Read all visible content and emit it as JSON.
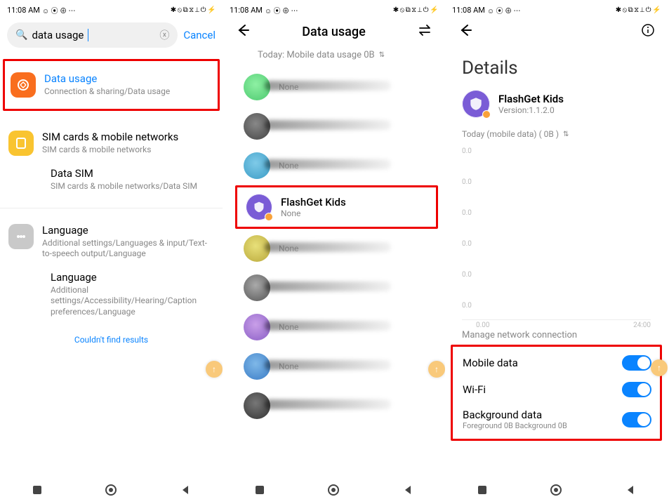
{
  "status": {
    "time": "11:08 AM",
    "left_icons": "☺ ⦿ ⊕ ⋯",
    "right_icons": "✱ ⦸ ⧉ ⧖ ⟂ ⏻ ⚡"
  },
  "panel1": {
    "search_value": "data usage",
    "cancel": "Cancel",
    "result1_title": "Data usage",
    "result1_path": "Connection & sharing/Data usage",
    "group2_title": "SIM cards & mobile networks",
    "group2_path": "SIM cards & mobile networks",
    "group2_sub_title": "Data SIM",
    "group2_sub_path": "SIM cards & mobile networks/Data SIM",
    "group3_title": "Language",
    "group3_path": "Additional settings/Languages & input/Text-to-speech output/Language",
    "group3b_title": "Language",
    "group3b_path": "Additional settings/Accessibility/Hearing/Caption preferences/Language",
    "nofind": "Couldn't find results"
  },
  "panel2": {
    "title": "Data usage",
    "filter": "Today: Mobile data usage 0B",
    "none": "None",
    "fk_name": "FlashGet Kids",
    "fk_sub": "None"
  },
  "panel3": {
    "title": "Details",
    "app_name": "FlashGet Kids",
    "app_version": "Version:1.1.2.0",
    "filter": "Today (mobile data) ( 0B )",
    "ylabel": "0.0",
    "x0": "0.00",
    "x1": "24:00",
    "section": "Manage network connection",
    "t1": "Mobile data",
    "t2": "Wi-Fi",
    "t3": "Background data",
    "t3_sub": "Foreground 0B  Background 0B"
  },
  "chart_data": {
    "type": "line",
    "title": "",
    "xlabel": "",
    "ylabel": "",
    "x_range": [
      "0.00",
      "24:00"
    ],
    "y_ticks": [
      0.0,
      0.0,
      0.0,
      0.0,
      0.0,
      0.0
    ],
    "series": [
      {
        "name": "mobile data",
        "values": []
      }
    ],
    "note": "empty chart — no visible data points, only repeated 0.0 y-tick labels"
  }
}
